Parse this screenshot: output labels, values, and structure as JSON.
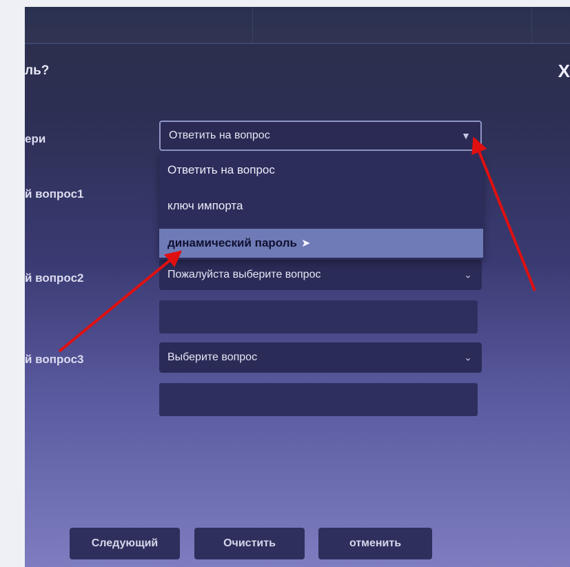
{
  "dialog": {
    "title": "ль?",
    "close": "X"
  },
  "rows": [
    {
      "label": "ери",
      "value": "Ответить на вопрос"
    },
    {
      "label": "й вопрос1"
    },
    {
      "label": "й вопрос2",
      "value": "Пожалуйста выберите вопрос"
    },
    {
      "label": "й вопрос3",
      "value": "Выберите вопрос"
    }
  ],
  "dropdown": {
    "options": [
      "Ответить на вопрос",
      "ключ импорта",
      "динамический пароль"
    ],
    "hovered_index": 2
  },
  "buttons": {
    "next": "Следующий",
    "clear": "Очистить",
    "cancel": "отменить"
  },
  "colors": {
    "annotation_arrow": "#e01010",
    "hover_highlight": "#6e7bb6"
  },
  "icons": [
    "chevron-down-icon",
    "close-icon",
    "cursor-icon",
    "annotation-arrow"
  ]
}
